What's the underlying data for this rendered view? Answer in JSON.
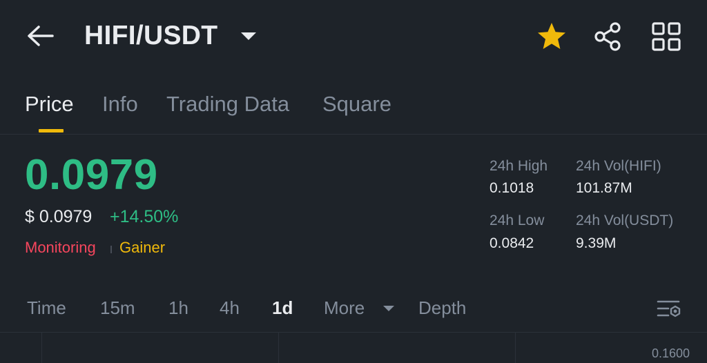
{
  "header": {
    "pair": "HIFI/USDT",
    "icons": [
      "arrow-left-icon",
      "caret-down-icon",
      "star-icon",
      "share-icon",
      "grid-apps-icon"
    ],
    "star_color": "#f0b90b"
  },
  "tabs": [
    {
      "label": "Price",
      "active": true
    },
    {
      "label": "Info",
      "active": false
    },
    {
      "label": "Trading Data",
      "active": false
    },
    {
      "label": "Square",
      "active": false
    }
  ],
  "price": {
    "last": "0.0979",
    "usd": "$ 0.0979",
    "change": "+14.50%",
    "up_color": "#2ebd85"
  },
  "tags": {
    "monitoring": "Monitoring",
    "gainer": "Gainer"
  },
  "stats": {
    "high_label": "24h High",
    "high_value": "0.1018",
    "low_label": "24h Low",
    "low_value": "0.0842",
    "vol_base_label": "24h Vol(HIFI)",
    "vol_base_value": "101.87M",
    "vol_quote_label": "24h Vol(USDT)",
    "vol_quote_value": "9.39M"
  },
  "intervals": {
    "items": [
      "Time",
      "15m",
      "1h",
      "4h",
      "1d"
    ],
    "selected": "1d",
    "more": "More",
    "depth": "Depth"
  },
  "chart": {
    "axis_label": "0.1600"
  },
  "colors": {
    "background": "#1e2329",
    "accent": "#f0b90b",
    "down": "#f6465d",
    "muted": "#848e9c"
  }
}
